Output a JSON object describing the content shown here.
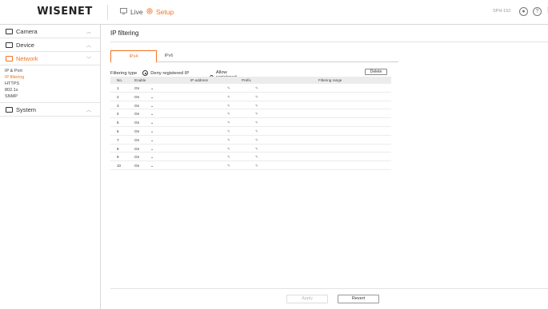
{
  "header": {
    "logo": "WISENET",
    "nav": [
      {
        "label": "Live",
        "active": false,
        "icon": "monitor-icon"
      },
      {
        "label": "Setup",
        "active": true,
        "icon": "gear-icon"
      }
    ],
    "model": "SPH-152",
    "icons": [
      "user-icon",
      "help-icon",
      "more-icon"
    ]
  },
  "sidebar": {
    "sections": [
      {
        "label": "Camera",
        "icon": "camera-icon",
        "active": false
      },
      {
        "label": "Device",
        "icon": "device-icon",
        "active": false
      },
      {
        "label": "Network",
        "icon": "network-icon",
        "active": true
      },
      {
        "label": "System",
        "icon": "system-icon",
        "active": false
      }
    ],
    "network_items": [
      "IP & Port",
      "IP filtering",
      "HTTPS",
      "802.1x",
      "SNMP"
    ],
    "active_item": "IP filtering"
  },
  "main": {
    "title": "IP filtering",
    "tabs": [
      "IPv4",
      "IPv6"
    ],
    "active_tab": "IPv4",
    "filtering_type_label": "Filtering type",
    "options": [
      "Deny registered IP",
      "Allow registered IP"
    ],
    "selected_option": "Deny registered IP",
    "delete_label": "Delete",
    "columns": [
      "No.",
      "Enable",
      "IP address",
      "Prefix",
      "Filtering range"
    ],
    "rows": [
      {
        "no": "1",
        "enable": "On"
      },
      {
        "no": "2",
        "enable": "On"
      },
      {
        "no": "3",
        "enable": "On"
      },
      {
        "no": "4",
        "enable": "On"
      },
      {
        "no": "5",
        "enable": "On"
      },
      {
        "no": "6",
        "enable": "On"
      },
      {
        "no": "7",
        "enable": "On"
      },
      {
        "no": "8",
        "enable": "On"
      },
      {
        "no": "9",
        "enable": "On"
      },
      {
        "no": "10",
        "enable": "On"
      }
    ],
    "apply_label": "Apply",
    "revert_label": "Revert"
  },
  "colors": {
    "accent": "#f37321"
  }
}
